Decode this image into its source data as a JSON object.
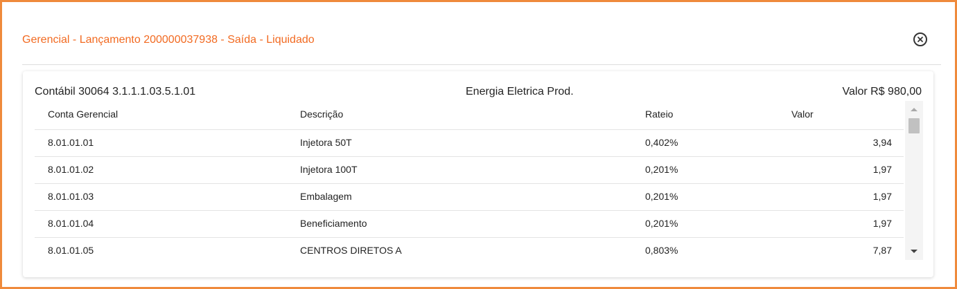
{
  "modal": {
    "title": "Gerencial - Lançamento 200000037938 - Saída - Liquidado",
    "close_icon": "close-circle-icon"
  },
  "summary": {
    "account": "Contábil 30064 3.1.1.1.03.5.1.01",
    "description": "Energia Eletrica Prod.",
    "value": "Valor R$ 980,00"
  },
  "table": {
    "headers": [
      "Conta Gerencial",
      "Descrição",
      "Rateio",
      "Valor"
    ],
    "rows": [
      {
        "conta": "8.01.01.01",
        "descricao": "Injetora 50T",
        "rateio": "0,402%",
        "valor": "3,94"
      },
      {
        "conta": "8.01.01.02",
        "descricao": "Injetora 100T",
        "rateio": "0,201%",
        "valor": "1,97"
      },
      {
        "conta": "8.01.01.03",
        "descricao": "Embalagem",
        "rateio": "0,201%",
        "valor": "1,97"
      },
      {
        "conta": "8.01.01.04",
        "descricao": "Beneficiamento",
        "rateio": "0,201%",
        "valor": "1,97"
      },
      {
        "conta": "8.01.01.05",
        "descricao": "CENTROS DIRETOS A",
        "rateio": "0,803%",
        "valor": "7,87"
      }
    ]
  },
  "colors": {
    "accent": "#f26a21",
    "frame_border": "#ef8a3b"
  }
}
